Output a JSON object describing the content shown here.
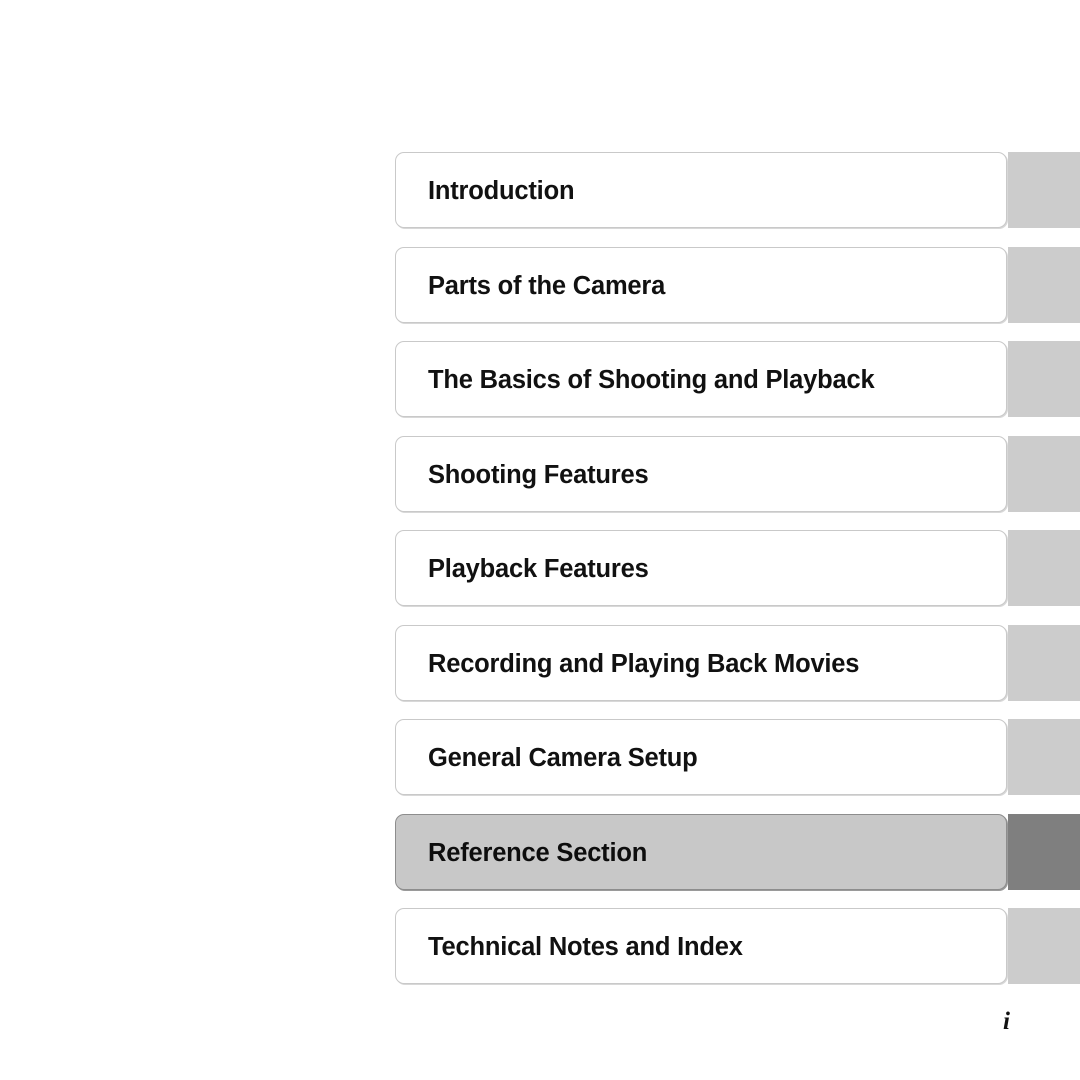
{
  "page": {
    "folio": "i",
    "background_color": "#ffffff"
  },
  "colors": {
    "plate_fill": "#ffffff",
    "plate_border": "#c9c9c9",
    "tab_fill": "#cccccc",
    "active_plate_fill": "#c8c8c8",
    "active_plate_border": "#8d8d8d",
    "active_tab_fill": "#7f7f7f",
    "title_text": "#111111"
  },
  "contents": {
    "chapters": [
      {
        "label": "Introduction",
        "active": false
      },
      {
        "label": "Parts of the Camera",
        "active": false
      },
      {
        "label": "The Basics of Shooting and Playback",
        "active": false
      },
      {
        "label": "Shooting Features",
        "active": false
      },
      {
        "label": "Playback Features",
        "active": false
      },
      {
        "label": "Recording and Playing Back Movies",
        "active": false
      },
      {
        "label": "General Camera Setup",
        "active": false
      },
      {
        "label": "Reference Section",
        "active": true
      },
      {
        "label": "Technical Notes and Index",
        "active": false
      }
    ]
  }
}
